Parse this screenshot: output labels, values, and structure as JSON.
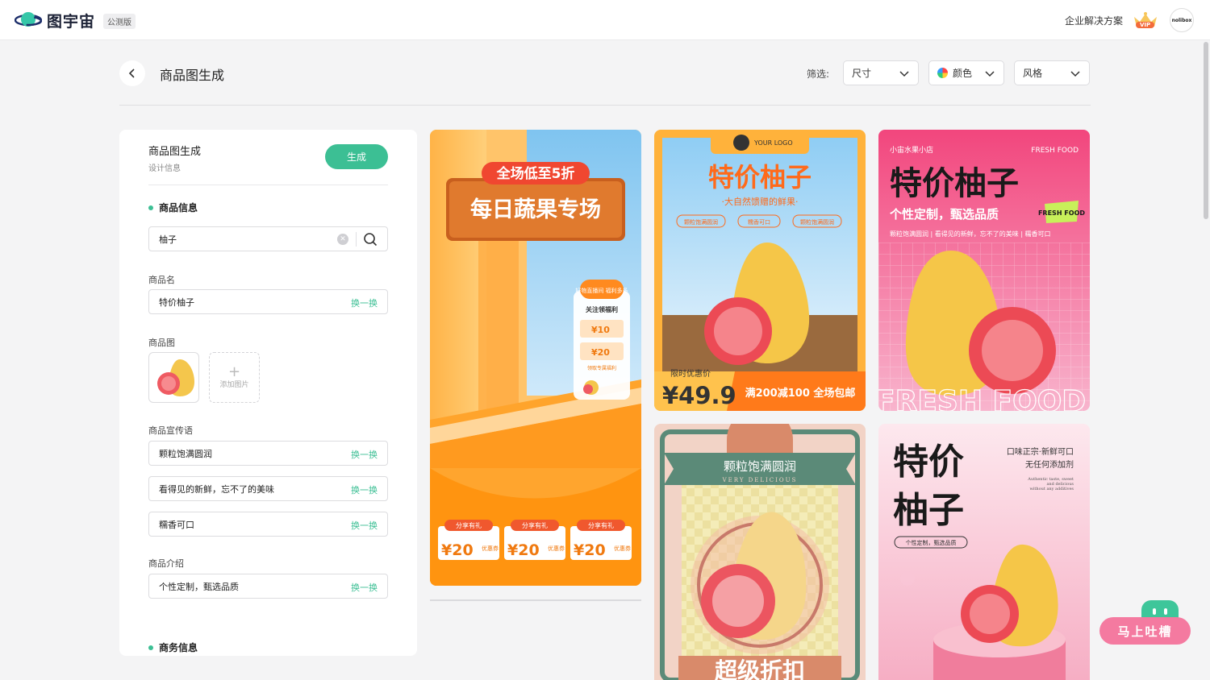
{
  "app": {
    "brand": "图宇宙",
    "beta_badge": "公测版",
    "enterprise_link": "企业解决方案",
    "vip_badge": "VIP",
    "avatar_text": "nolibox"
  },
  "header": {
    "title": "商品图生成",
    "filter_label": "筛选:",
    "filters": {
      "size": "尺寸",
      "color": "颜色",
      "style": "风格"
    }
  },
  "panel": {
    "title": "商品图生成",
    "subtitle": "设计信息",
    "generate_button": "生成",
    "product_info_heading": "商品信息",
    "search_value": "柚子",
    "name_label": "商品名",
    "name_value": "特价柚子",
    "image_label": "商品图",
    "add_image": "添加图片",
    "slogan_label": "商品宣传语",
    "slogans": [
      "颗粒饱满圆润",
      "看得见的新鲜，忘不了的美味",
      "糯香可口"
    ],
    "intro_label": "商品介绍",
    "intro_value": "个性定制，甄选品质",
    "swap_label": "换一换",
    "business_heading": "商务信息"
  },
  "cards": {
    "c1": {
      "banner_top": "全场低至5折",
      "banner_main": "每日蔬果专场",
      "side_bubble": "好物直播间 福利多多",
      "side_title": "关注领福利",
      "side_coupon1": "¥10",
      "side_coupon2": "¥20",
      "side_tag": "领取专属福利",
      "share_label": "分享有礼",
      "coupon_value": "¥20",
      "coupon_note": "优惠券"
    },
    "c2": {
      "logo": "YOUR LOGO",
      "title": "特价柚子",
      "subtitle": "·大自然馈赠的鲜果·",
      "tags": [
        "颗粒饱满圆润",
        "糯香可口",
        "颗粒饱满圆润"
      ],
      "price_label": "限时优惠价",
      "price": "¥49.9",
      "promo": "满200减100 全场包邮"
    },
    "c3": {
      "shop": "小宙水果小店",
      "fresh": "FRESH FOOD",
      "title": "特价柚子",
      "subtitle": "个性定制，甄选品质",
      "badge": "FRESH FOOD",
      "tagline": "颗粒饱满圆润 | 看得见的新鲜，忘不了的美味 | 糯香可口",
      "bottom_text": "FRESH FOOD"
    },
    "c4": {
      "ribbon": "颗粒饱满圆润",
      "sub": "VERY DELICIOUS",
      "bottom": "超级折扣"
    },
    "c5": {
      "title_line1": "特价",
      "title_line2": "柚子",
      "note1": "口味正宗·新鲜可口",
      "note2": "无任何添加剂",
      "en1": "Authentic taste, sweet",
      "en2": "and delicious",
      "en3": "without any additives",
      "tag": "个性定制，甄选品质"
    }
  },
  "feedback": {
    "label": "马上吐槽"
  },
  "colors": {
    "accent": "#3cbf94",
    "feedback": "#f47aa0",
    "orange": "#ff8a1f",
    "pink": "#f2467d"
  }
}
